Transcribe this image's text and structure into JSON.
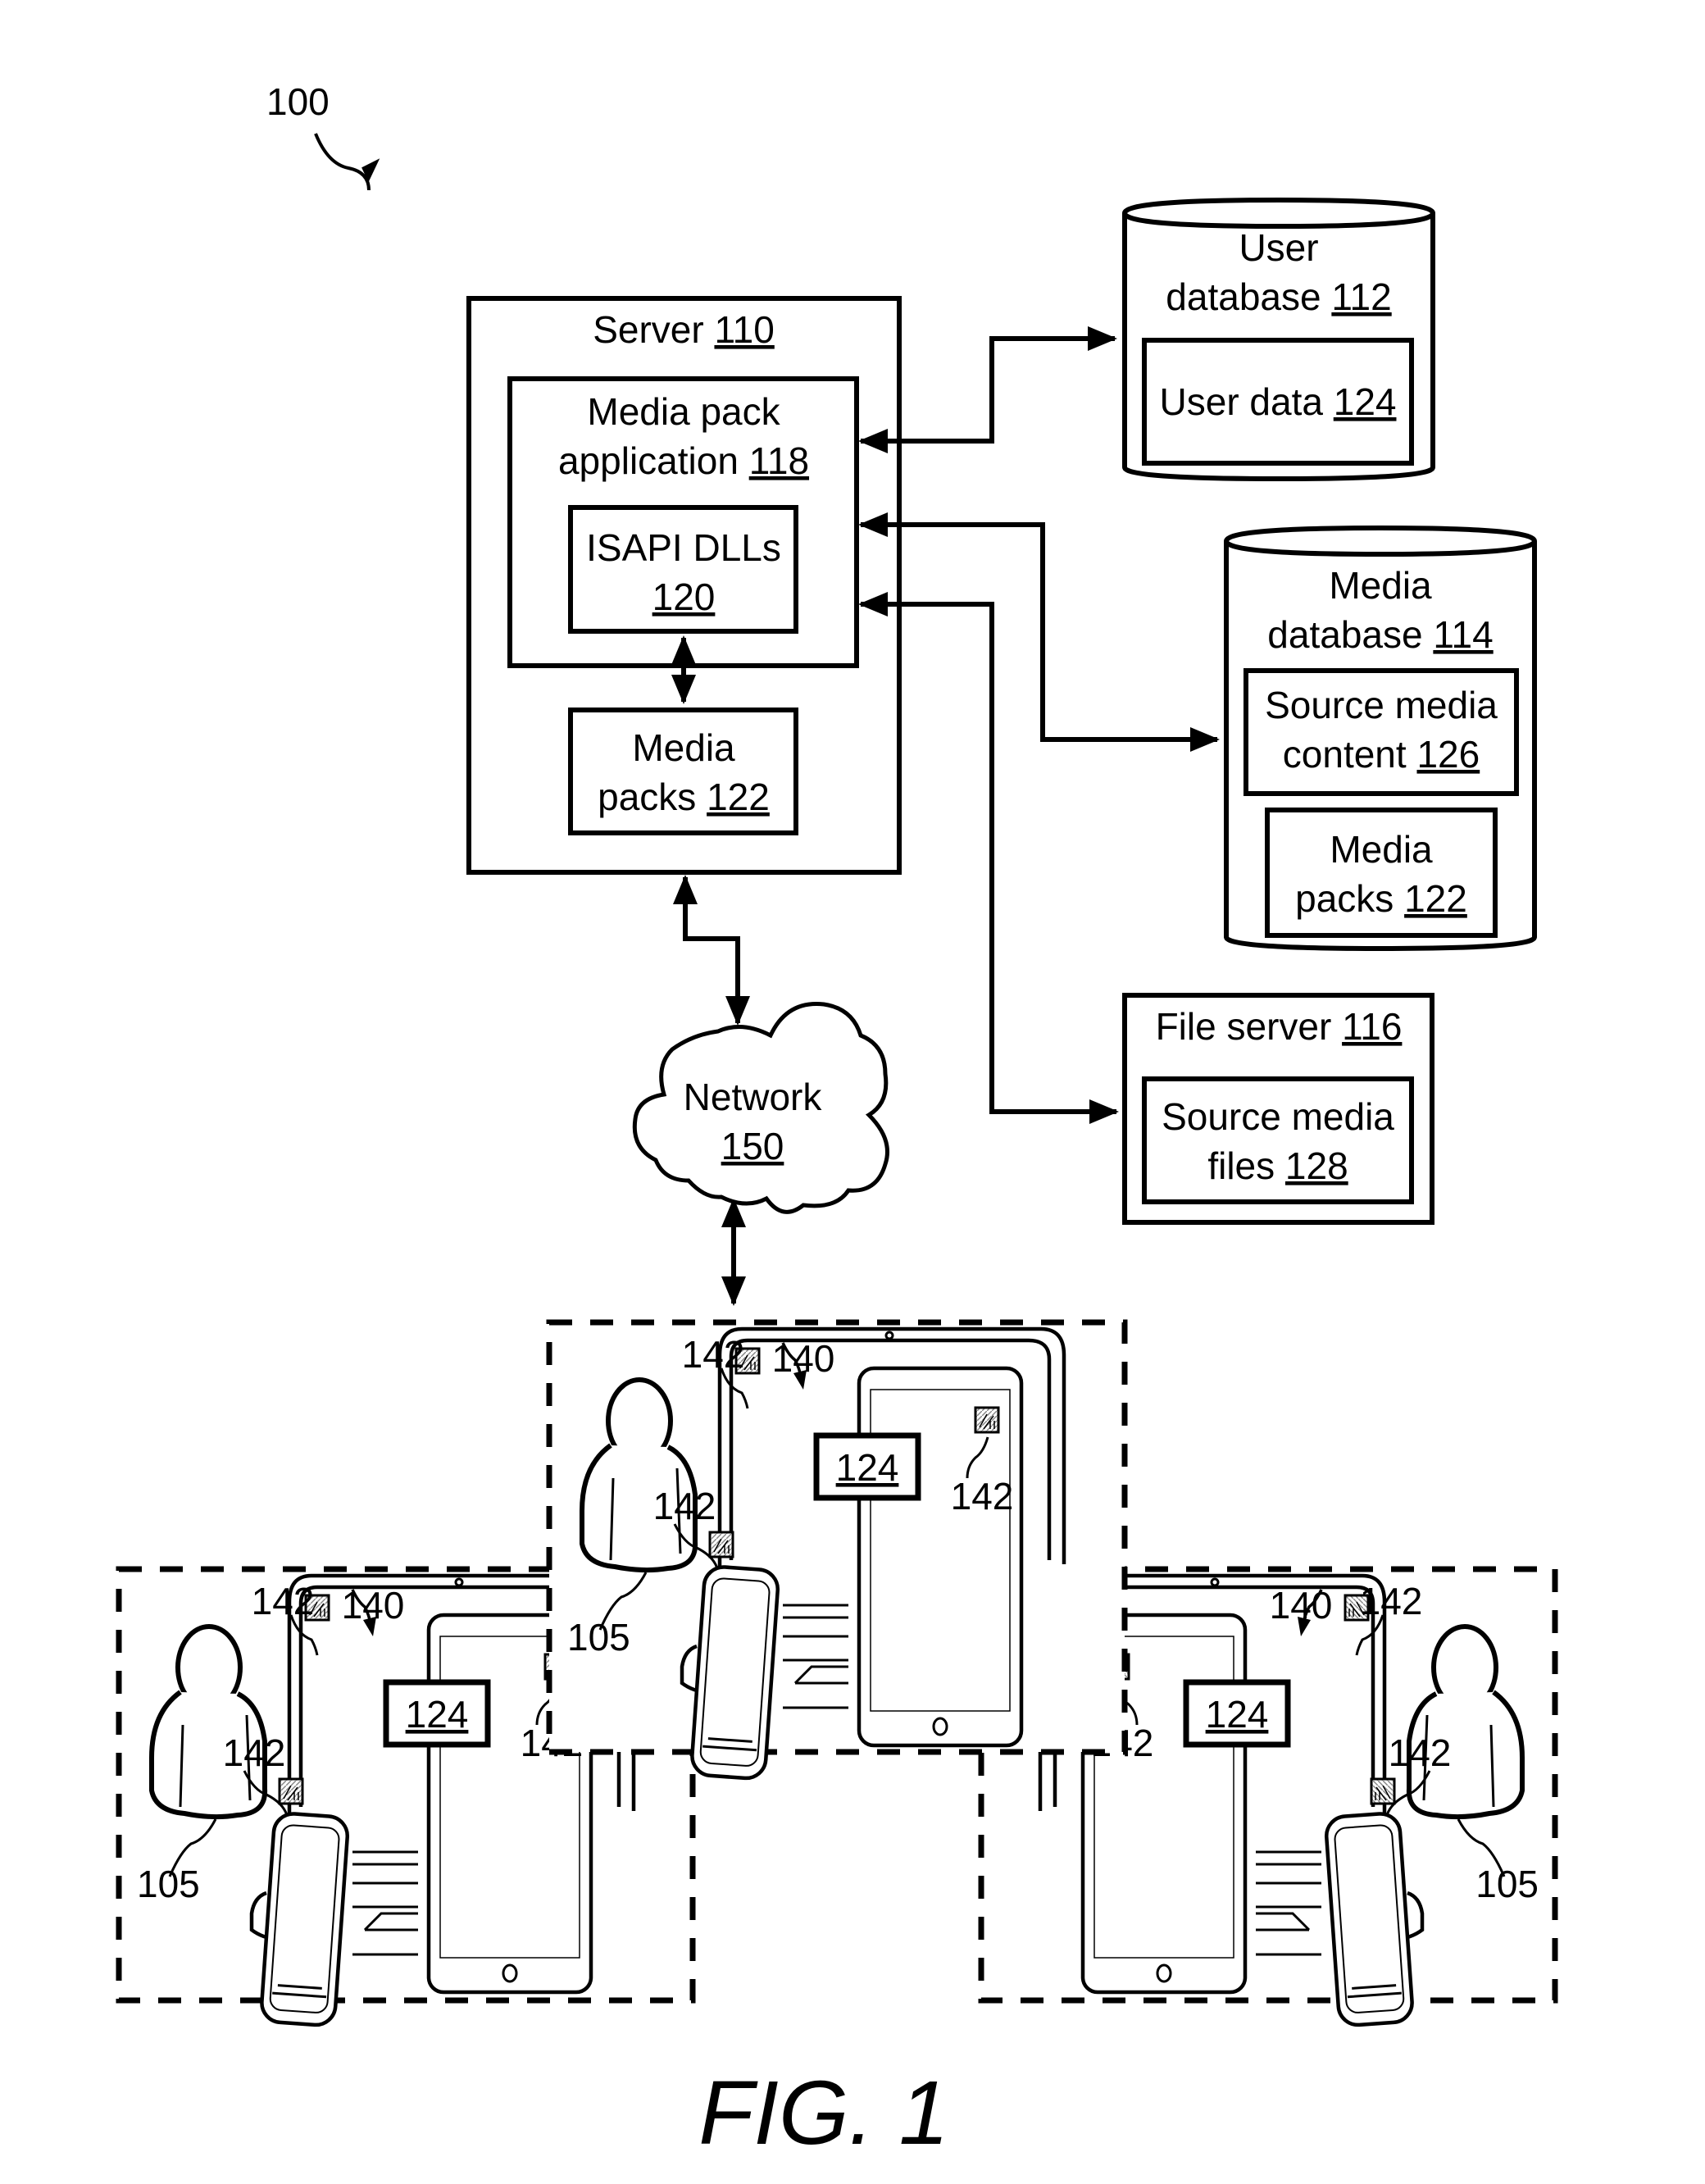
{
  "figure": {
    "reference_number": "100",
    "caption": "FIG. 1"
  },
  "server": {
    "label": "Server",
    "ref": "110",
    "media_pack_application": {
      "line1": "Media pack",
      "line2": "application",
      "ref": "118"
    },
    "isapi_dlls": {
      "label": "ISAPI DLLs",
      "ref": "120"
    },
    "media_packs": {
      "line1": "Media",
      "line2": "packs",
      "ref": "122"
    }
  },
  "user_database": {
    "line1": "User",
    "line2": "database",
    "ref": "112",
    "user_data": {
      "label": "User data",
      "ref": "124"
    }
  },
  "media_database": {
    "line1": "Media",
    "line2": "database",
    "ref": "114",
    "source_media_content": {
      "line1": "Source media",
      "line2": "content",
      "ref": "126"
    },
    "media_packs": {
      "line1": "Media",
      "line2": "packs",
      "ref": "122"
    }
  },
  "file_server": {
    "label": "File server",
    "ref": "116",
    "source_media_files": {
      "line1": "Source media",
      "line2": "files",
      "ref": "128"
    }
  },
  "network": {
    "label": "Network",
    "ref": "150"
  },
  "clusters": [
    {
      "position": "center",
      "user_ref": "105",
      "devices_ref": "140",
      "icon_ref": "142",
      "user_data_ref": "124"
    },
    {
      "position": "left",
      "user_ref": "105",
      "devices_ref": "140",
      "icon_ref": "142",
      "user_data_ref": "124"
    },
    {
      "position": "right",
      "user_ref": "105",
      "devices_ref": "140",
      "icon_ref": "142",
      "user_data_ref": "124"
    }
  ]
}
